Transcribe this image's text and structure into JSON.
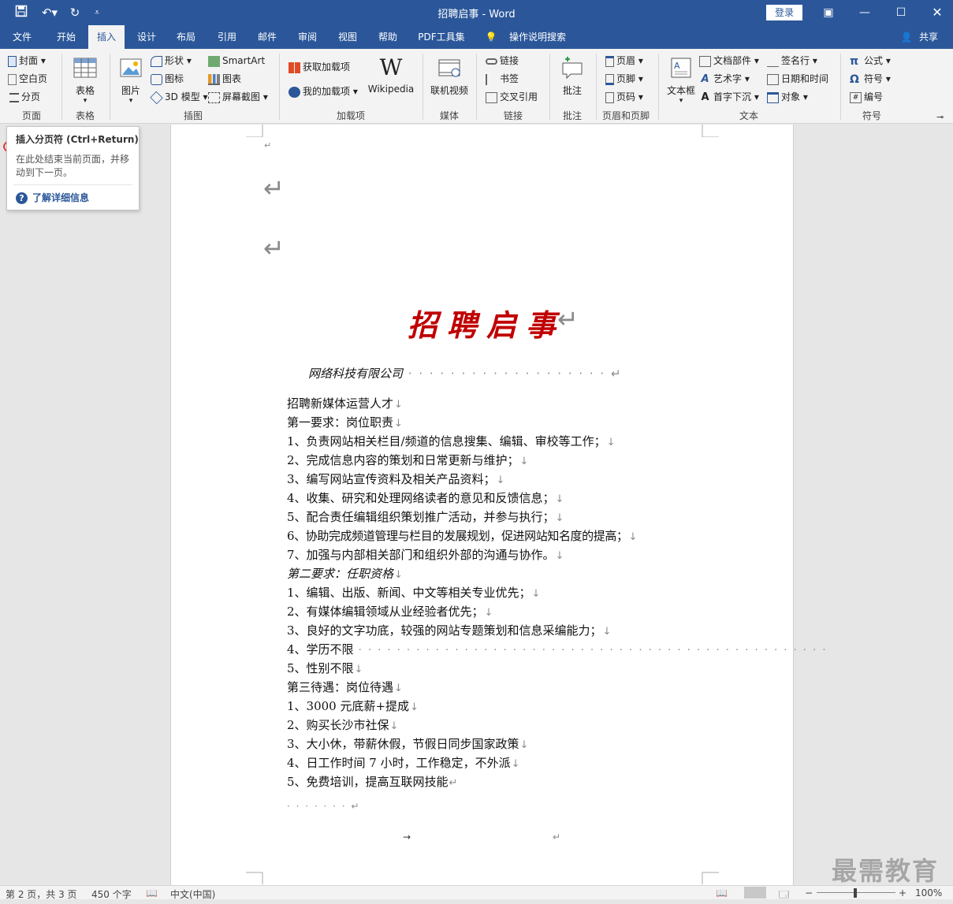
{
  "titlebar": {
    "title": "招聘启事  -  Word",
    "login": "登录"
  },
  "tabs": [
    "文件",
    "开始",
    "插入",
    "设计",
    "布局",
    "引用",
    "邮件",
    "审阅",
    "视图",
    "帮助",
    "PDF工具集",
    "操作说明搜索"
  ],
  "active_tab": "插入",
  "share": "共享",
  "ribbon": {
    "pages": {
      "cover": "封面",
      "blank": "空白页",
      "break": "分页",
      "group": "页面"
    },
    "table": {
      "label": "表格",
      "group": "表格"
    },
    "illustrations": {
      "picture": "图片",
      "shapes": "形状",
      "icons": "图标",
      "model3d": "3D 模型",
      "smartart": "SmartArt",
      "chart": "图表",
      "screenshot": "屏幕截图",
      "group": "插图"
    },
    "addins": {
      "get": "获取加载项",
      "my": "我的加载项",
      "wiki": "Wikipedia",
      "group": "加载项"
    },
    "media": {
      "online_video": "联机视频",
      "group": "媒体"
    },
    "links": {
      "link": "链接",
      "bookmark": "书签",
      "crossref": "交叉引用",
      "group": "链接"
    },
    "comments": {
      "comment": "批注",
      "group": "批注"
    },
    "header_footer": {
      "header": "页眉",
      "footer": "页脚",
      "page_number": "页码",
      "group": "页眉和页脚"
    },
    "text": {
      "textbox": "文本框",
      "quickparts": "文档部件",
      "wordart": "艺术字",
      "dropcap": "首字下沉",
      "signature": "签名行",
      "datetime": "日期和时间",
      "object": "对象",
      "group": "文本"
    },
    "symbols": {
      "equation": "公式",
      "symbol": "符号",
      "number": "编号",
      "group": "符号"
    }
  },
  "tooltip": {
    "title": "插入分页符 (Ctrl+Return)",
    "desc": "在此处结束当前页面，并移动到下一页。",
    "link": "了解详细信息"
  },
  "document": {
    "title": "招聘启事",
    "company": "网络科技有限公司",
    "lines": [
      "招聘新媒体运营人才",
      "第一要求：岗位职责",
      "1、负责网站相关栏目/频道的信息搜集、编辑、审校等工作；",
      "2、完成信息内容的策划和日常更新与维护；",
      "3、编写网站宣传资料及相关产品资料；",
      "4、收集、研究和处理网络读者的意见和反馈信息；",
      "5、配合责任编辑组织策划推广活动，并参与执行；",
      "6、协助完成频道管理与栏目的发展规划，促进网站知名度的提高；",
      "7、加强与内部相关部门和组织外部的沟通与协作。",
      "第二要求：任职资格",
      "1、编辑、出版、新闻、中文等相关专业优先；",
      "2、有媒体编辑领域从业经验者优先；",
      "3、良好的文字功底，较强的网站专题策划和信息采编能力；",
      "4、学历不限",
      "5、性别不限",
      "第三待遇：岗位待遇",
      "1、3000 元底薪+提成",
      "2、购买长沙市社保",
      "3、大小休，带薪休假，节假日同步国家政策",
      "4、日工作时间 7 小时，工作稳定，不外派",
      "5、免费培训，提高互联网技能"
    ]
  },
  "statusbar": {
    "page": "第 2 页，共 3 页",
    "words": "450 个字",
    "lang": "中文(中国)",
    "zoom": "100%"
  },
  "watermark": "最需教育"
}
